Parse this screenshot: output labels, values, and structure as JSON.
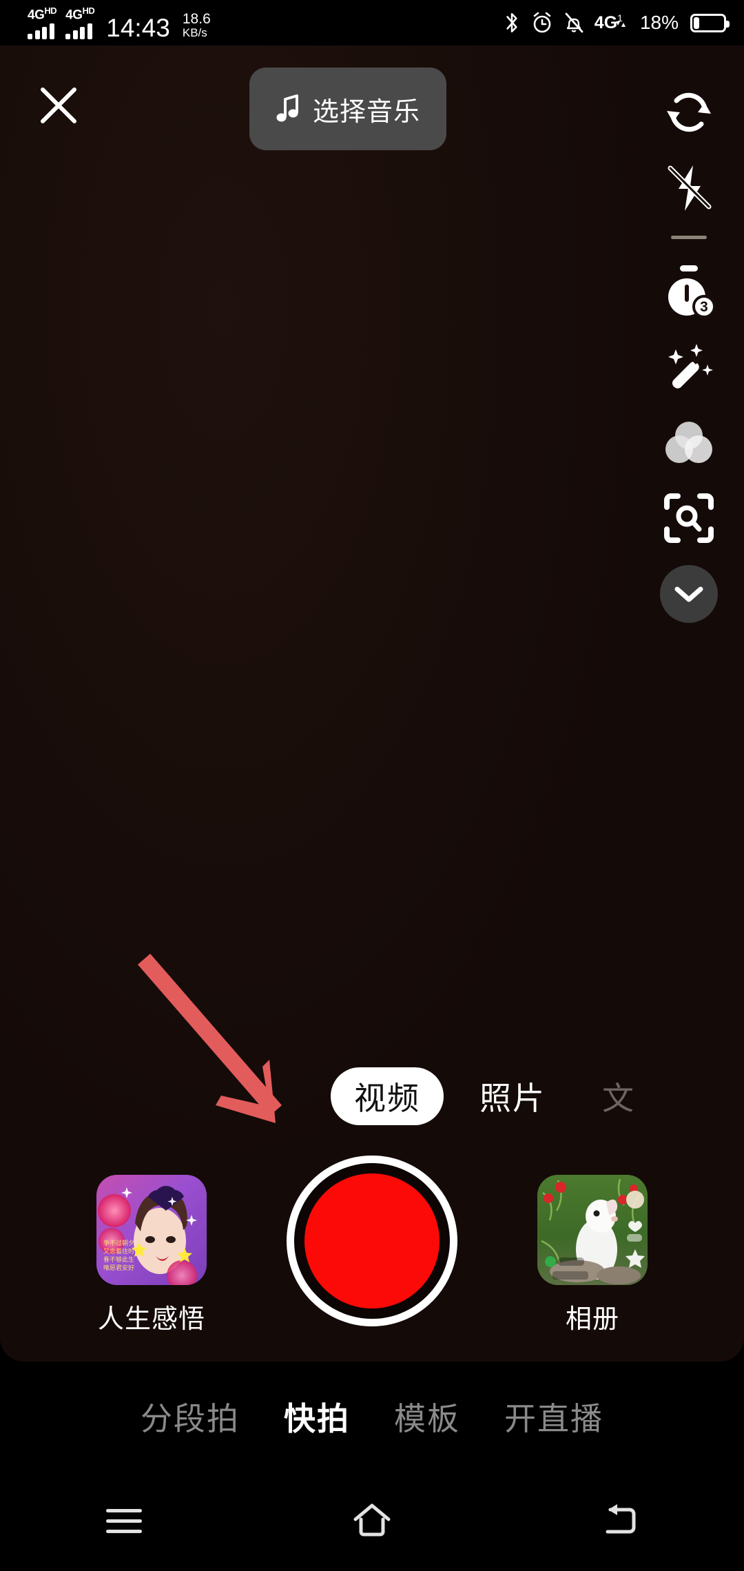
{
  "status_bar": {
    "sim1": {
      "network": "4G",
      "network_sup": "HD",
      "bars": 4
    },
    "sim2": {
      "network": "4G",
      "network_sup": "HD",
      "bars": 4
    },
    "time": "14:43",
    "net_speed_value": "18.6",
    "net_speed_unit": "KB/s",
    "icons": [
      "bluetooth-icon",
      "alarm-icon",
      "bell-muted-icon",
      "4g-data-icon"
    ],
    "data_label": "4G",
    "data_label_sub": "1",
    "battery_percent": "18%",
    "battery_level": 18
  },
  "topbar": {
    "close_label": "close-icon",
    "music_icon": "music-note-icon",
    "music_label": "选择音乐"
  },
  "tools": [
    {
      "name": "flip-camera-icon",
      "label": "翻转"
    },
    {
      "name": "flash-off-icon",
      "label": "闪光灯关闭"
    },
    {
      "name": "timer-icon",
      "label": "倒计时",
      "badge": "3"
    },
    {
      "name": "beauty-wand-icon",
      "label": "美化"
    },
    {
      "name": "filter-icon",
      "label": "滤镜"
    },
    {
      "name": "scan-icon",
      "label": "扫一扫"
    },
    {
      "name": "chevron-down-icon",
      "label": "展开更多"
    }
  ],
  "annotation": {
    "arrow": "red-down-right-arrow",
    "color": "#e25c5c"
  },
  "modes": [
    {
      "label": "视频",
      "selected": true
    },
    {
      "label": "照片",
      "selected": false
    },
    {
      "label": "文",
      "selected": false,
      "clipped": true
    }
  ],
  "capture": {
    "effect": {
      "label": "人生感悟",
      "thumb": "beauty-effect-thumbnail"
    },
    "shutter": {
      "label": "shutter-button",
      "color": "#fb0a07"
    },
    "album": {
      "label": "相册",
      "thumb": "rabbit-photo-thumbnail"
    }
  },
  "bottom_tabs": [
    {
      "label": "分段拍",
      "active": false
    },
    {
      "label": "快拍",
      "active": true
    },
    {
      "label": "模板",
      "active": false
    },
    {
      "label": "开直播",
      "active": false
    }
  ],
  "navbar": [
    {
      "name": "recents-icon"
    },
    {
      "name": "home-icon"
    },
    {
      "name": "back-icon"
    }
  ],
  "colors": {
    "viewfinder_bg": "#190d0a",
    "accent_red": "#fb0a07",
    "pill_bg": "#4a4a4a",
    "inactive_text": "#8a8a8a"
  }
}
